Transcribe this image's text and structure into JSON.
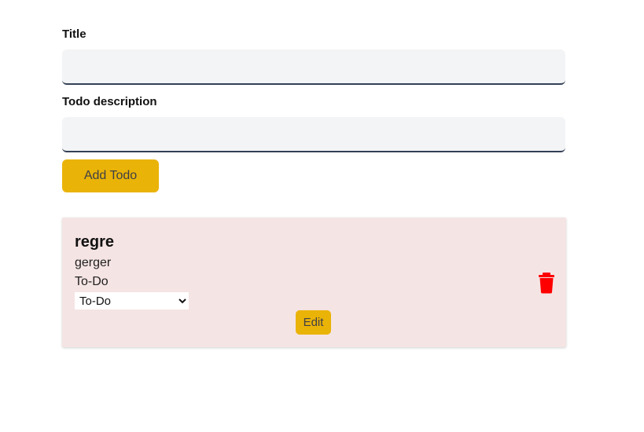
{
  "form": {
    "title_label": "Title",
    "title_value": "",
    "description_label": "Todo description",
    "description_value": "",
    "add_button_label": "Add Todo"
  },
  "todos": [
    {
      "title": "regre",
      "description": "gerger",
      "status": "To-Do",
      "status_options": [
        "To-Do"
      ],
      "selected_status": "To-Do",
      "edit_label": "Edit",
      "delete_icon": "trash-icon"
    }
  ],
  "colors": {
    "button_accent": "#eab308",
    "card_background": "#f5e4e4",
    "delete_icon": "#ff0000",
    "input_background": "#f3f4f6"
  }
}
